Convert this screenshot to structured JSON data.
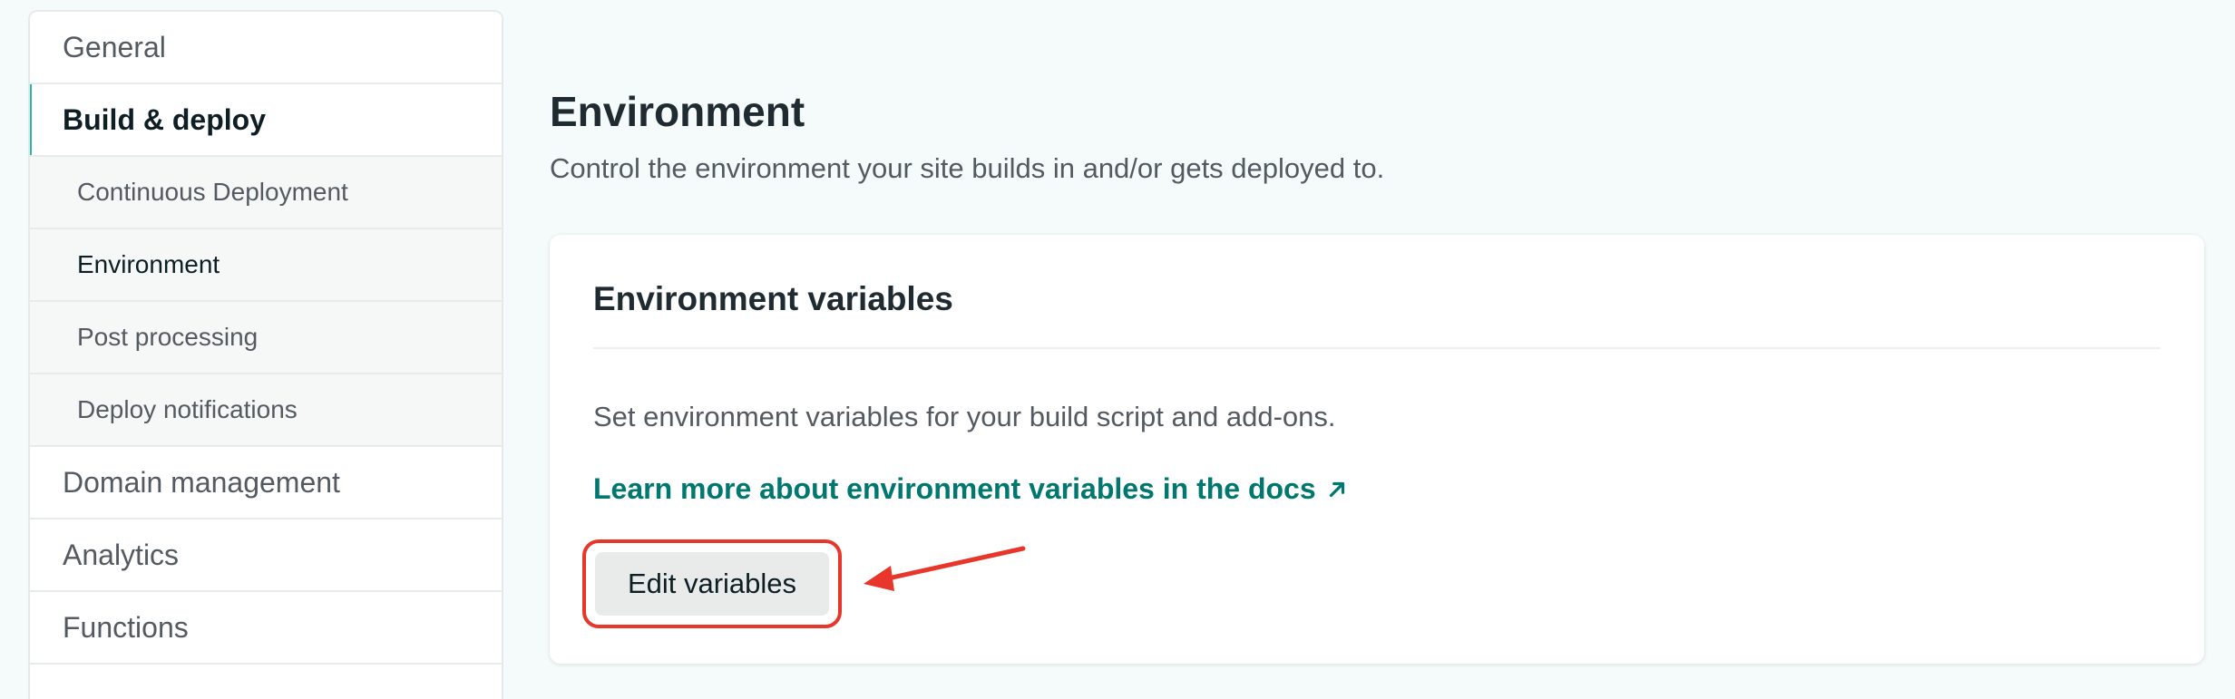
{
  "sidebar": {
    "items": [
      {
        "label": "General"
      },
      {
        "label": "Build & deploy"
      },
      {
        "label": "Continuous Deployment"
      },
      {
        "label": "Environment"
      },
      {
        "label": "Post processing"
      },
      {
        "label": "Deploy notifications"
      },
      {
        "label": "Domain management"
      },
      {
        "label": "Analytics"
      },
      {
        "label": "Functions"
      }
    ]
  },
  "main": {
    "title": "Environment",
    "subtitle": "Control the environment your site builds in and/or gets deployed to.",
    "card": {
      "title": "Environment variables",
      "description": "Set environment variables for your build script and add-ons.",
      "docs_link": "Learn more about environment variables in the docs",
      "docs_link_icon": "arrow-up-right-icon",
      "edit_button": "Edit variables"
    }
  },
  "colors": {
    "accent": "#30b4a8",
    "link": "#00776f",
    "annotation": "#e8362a",
    "background": "#f4fbfa"
  }
}
